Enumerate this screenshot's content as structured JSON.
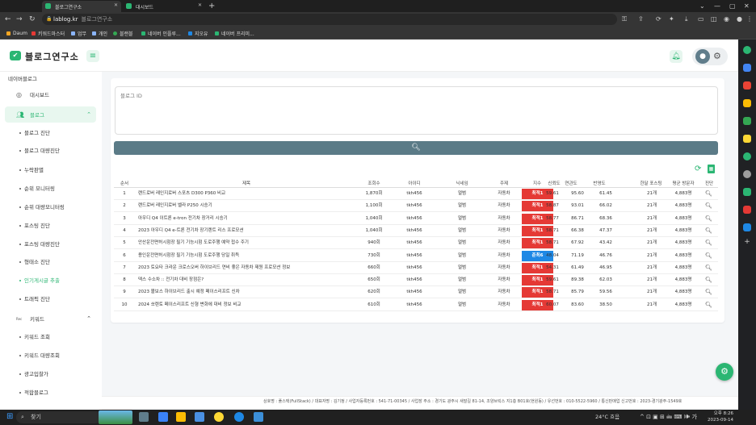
{
  "browser": {
    "tabs": [
      {
        "title": "블로그연구소",
        "active": true
      },
      {
        "title": "대시보드",
        "active": false
      }
    ],
    "url_host": "lablog.kr",
    "url_rest": "블로그연구소",
    "bookmarks": [
      "Daum",
      "키워드마스터",
      "업무",
      "개인",
      "블랜블",
      "네이버 인플루...",
      "지오유",
      "네이버 프리미..."
    ]
  },
  "app": {
    "logo_badge": "✔",
    "logo_text": "블로그연구소",
    "brand_color": "#2bb673"
  },
  "sidebar": {
    "section_title": "네이버블로그",
    "dashboard": "대시보드",
    "blog_group": "블로그",
    "blog_items": [
      "블로그 진단",
      "블로그 대량진단",
      "누락판별",
      "순위 모니터링",
      "순위 대량모니터링",
      "포스팅 진단",
      "포스팅 대량진단",
      "형태소 진단",
      "인기게시글 추출",
      "트래픽 진단"
    ],
    "active_item": "인기게시글 추출",
    "keyword_prefix": "Rec",
    "keyword_group": "키워드",
    "keyword_items": [
      "키워드 조회",
      "키워드 대량조회",
      "광고입찰가",
      "적합블로그"
    ]
  },
  "form": {
    "blog_id_label": "블로그 ID"
  },
  "table": {
    "headers": [
      "순서",
      "제목",
      "조회수",
      "아이디",
      "닉네임",
      "주제",
      "지수",
      "신뢰도",
      "연관도",
      "반영도",
      "한달 포스팅",
      "평균 방문자",
      "진단"
    ],
    "rows": [
      [
        "1",
        "랜드로버 레인지로버 스포츠 D300 P360 비교",
        "1,870회",
        "tkh456",
        "얼범",
        "자동차",
        "최적1",
        "59.61",
        "95.60",
        "61.45",
        "21개",
        "4,883명"
      ],
      [
        "2",
        "랜드로버 레인지로버 벨라 P250 시승기",
        "1,100회",
        "tkh456",
        "얼범",
        "자동차",
        "최적1",
        "58.87",
        "93.01",
        "66.02",
        "21개",
        "4,883명"
      ],
      [
        "3",
        "아우디 Q4 이트론 e-tron 전기차 장거리 시승기",
        "1,040회",
        "tkh456",
        "얼범",
        "자동차",
        "최적1",
        "58.77",
        "86.71",
        "68.36",
        "21개",
        "4,883명"
      ],
      [
        "4",
        "2023 아우디 Q4 e-트론 전기차 장기렌트 리스 프로모션",
        "1,040회",
        "tkh456",
        "얼범",
        "자동차",
        "최적1",
        "58.71",
        "66.38",
        "47.37",
        "21개",
        "4,883명"
      ],
      [
        "5",
        "안산운전면허시험장 필기 기능시험 도로주행 예약 접수 주기",
        "940회",
        "tkh456",
        "얼범",
        "자동차",
        "최적1",
        "58.71",
        "67.92",
        "43.42",
        "21개",
        "4,883명"
      ],
      [
        "6",
        "용인운전면허시험장 필기 기능시험 도로주행 당일 취득",
        "730회",
        "tkh456",
        "얼범",
        "자동차",
        "준최6",
        "48.04",
        "71.19",
        "46.76",
        "21개",
        "4,883명"
      ],
      [
        "7",
        "2023 토요타 크라운 크로스오버 하이브리드 연비 좋은 자동차 제원 프로모션 정보",
        "660회",
        "tkh456",
        "얼범",
        "자동차",
        "최적1",
        "54.31",
        "61.49",
        "46.95",
        "21개",
        "4,883명"
      ],
      [
        "8",
        "덱스 수소차 :: 전기차 대비 장점은?",
        "650회",
        "tkh456",
        "얼범",
        "자동차",
        "최적1",
        "59.61",
        "89.38",
        "62.03",
        "21개",
        "4,883명"
      ],
      [
        "9",
        "2023 볼보스 하이브리드 출시 예정 페이스리프트 신차",
        "620회",
        "tkh456",
        "얼범",
        "자동차",
        "최적1",
        "58.71",
        "85.79",
        "59.56",
        "21개",
        "4,883명"
      ],
      [
        "10",
        "2024 쏘렌토 페이스리프트 신형 변화에 대비 정보 비교",
        "610회",
        "tkh456",
        "얼범",
        "자동차",
        "최적1",
        "60.07",
        "83.60",
        "38.50",
        "21개",
        "4,883명"
      ]
    ],
    "badge_colors": {
      "최적1": "#e53935",
      "준최6": "#1e88e5"
    }
  },
  "footer": {
    "text": "상호명 : 풀스택(FullStack) / 대표자명 : 김기정 / 사업자등록번호 : 541-71-00345 / 사업장 주소 : 경기도 광주시 새말길 81-14, 조양브릭스 지1층 B01호(현원동) / 유선번호 : 010-5522-5960 / 통신판매업 신고번호 : 2023-경기광주-1549호"
  },
  "taskbar": {
    "search_placeholder": "찾기",
    "weather": "24°C 흐음",
    "tray": "^ ⊡ ▣ ⊞ 🖮 ⌨ 🕪 가",
    "time": "오후 8:26",
    "date": "2023-09-14"
  }
}
